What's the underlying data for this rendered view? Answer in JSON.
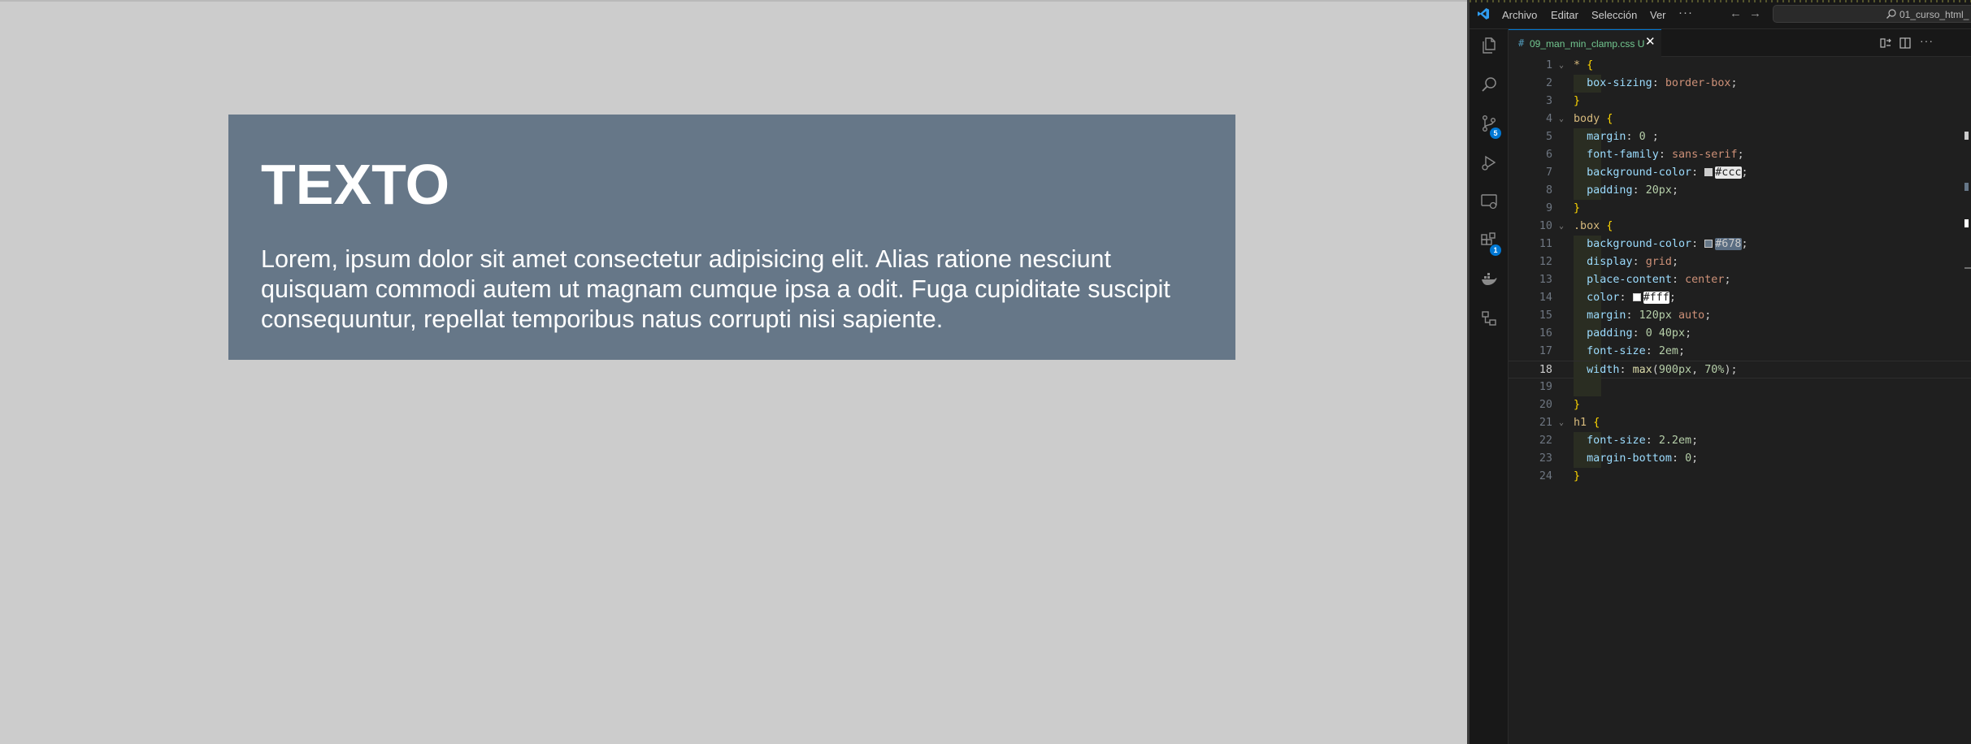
{
  "preview": {
    "heading": "TEXTO",
    "paragraph": "Lorem, ipsum dolor sit amet consectetur adipisicing elit. Alias ratione nesciunt quisquam commodi autem ut magnam cumque ipsa a odit. Fuga cupiditate suscipit consequuntur, repellat temporibus natus corrupti nisi sapiente.",
    "colors": {
      "page_bg": "#cccccc",
      "box_bg": "#667788",
      "text": "#ffffff"
    }
  },
  "vscode": {
    "menu": [
      "Archivo",
      "Editar",
      "Selección",
      "Ver"
    ],
    "more_menu": "···",
    "search_text": "01_curso_html_",
    "activity_badges": {
      "source_control": "5",
      "extensions": "1"
    },
    "tab": {
      "name": "09_man_min_clamp.css",
      "status": "U",
      "icon": "#"
    },
    "current_line": 18,
    "lines": [
      {
        "n": "1",
        "fold": true,
        "html": "<span class=\"sel\">*</span> <span class=\"brace\">{</span>"
      },
      {
        "n": "2",
        "guide": true,
        "html": "  <span class=\"prop\">box-sizing</span>: <span class=\"val\">border-box</span>;"
      },
      {
        "n": "3",
        "html": "<span class=\"brace\">}</span>"
      },
      {
        "n": "4",
        "fold": true,
        "html": "<span class=\"sel\">body</span> <span class=\"brace\">{</span>"
      },
      {
        "n": "5",
        "guide": true,
        "html": "  <span class=\"prop\">margin</span>: <span class=\"num\">0</span> ;"
      },
      {
        "n": "6",
        "guide": true,
        "html": "  <span class=\"prop\">font-family</span>: <span class=\"val\">sans-serif</span>;"
      },
      {
        "n": "7",
        "guide": true,
        "html": "  <span class=\"prop\">background-color</span>: <span class=\"swatch\" style=\"background:#cccccc\"></span><span class=\"hl-light\">#ccc</span>;"
      },
      {
        "n": "8",
        "guide": true,
        "html": "  <span class=\"prop\">padding</span>: <span class=\"num\">20px</span>;"
      },
      {
        "n": "9",
        "html": "<span class=\"brace\">}</span>"
      },
      {
        "n": "10",
        "fold": true,
        "html": "<span class=\"sel\">.box</span> <span class=\"brace\">{</span>"
      },
      {
        "n": "11",
        "guide": true,
        "html": "  <span class=\"prop\">background-color</span>: <span class=\"swatch\" style=\"background:#667788\"></span><span class=\"hl-blue\">#678</span>;"
      },
      {
        "n": "12",
        "guide": true,
        "html": "  <span class=\"prop\">display</span>: <span class=\"val\">grid</span>;"
      },
      {
        "n": "13",
        "guide": true,
        "html": "  <span class=\"prop\">place-content</span>: <span class=\"val\">center</span>;"
      },
      {
        "n": "14",
        "guide": true,
        "html": "  <span class=\"prop\">color</span>: <span class=\"swatch\" style=\"background:#ffffff\"></span><span class=\"hl-white\">#fff</span>;"
      },
      {
        "n": "15",
        "guide": true,
        "html": "  <span class=\"prop\">margin</span>: <span class=\"num\">120px</span> <span class=\"val\">auto</span>;"
      },
      {
        "n": "16",
        "guide": true,
        "html": "  <span class=\"prop\">padding</span>: <span class=\"num\">0</span> <span class=\"num\">40px</span>;"
      },
      {
        "n": "17",
        "guide": true,
        "html": "  <span class=\"prop\">font-size</span>: <span class=\"num\">2em</span>;"
      },
      {
        "n": "18",
        "guide": true,
        "html": "  <span class=\"prop\">width</span>: <span class=\"fn\">max</span>(<span class=\"num\">900px</span>, <span class=\"num\">70%</span>);"
      },
      {
        "n": "19",
        "guide": true,
        "html": ""
      },
      {
        "n": "20",
        "html": "<span class=\"brace\">}</span>"
      },
      {
        "n": "21",
        "fold": true,
        "html": "<span class=\"sel\">h1</span> <span class=\"brace\">{</span>"
      },
      {
        "n": "22",
        "guide": true,
        "html": "  <span class=\"prop\">font-size</span>: <span class=\"num\">2.2em</span>;"
      },
      {
        "n": "23",
        "guide": true,
        "html": "  <span class=\"prop\">margin-bottom</span>: <span class=\"num\">0</span>;"
      },
      {
        "n": "24",
        "html": "<span class=\"brace\">}</span>"
      }
    ]
  }
}
